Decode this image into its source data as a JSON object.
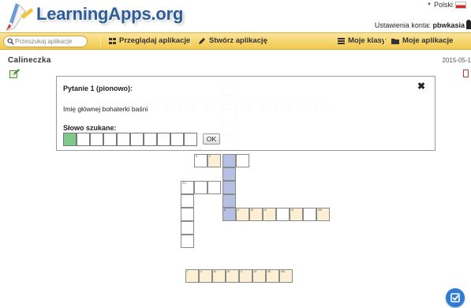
{
  "header": {
    "logo_text": "LearningApps.org",
    "language": "Polski",
    "account_prefix": "Ustawienia konta:",
    "account_user": "pbwkasia"
  },
  "nav": {
    "search_placeholder": "Przeszukaj aplikacje",
    "browse": "Przeglądaj aplikacje",
    "create": "Stwórz aplikację",
    "classes": "Moje klasy",
    "my_apps": "Moje aplikacje"
  },
  "page": {
    "title": "Calineczka",
    "date": "2015-05-1"
  },
  "dialog": {
    "title": "Pytanie 1 (pionowo):",
    "clue": "Imię głównej bohaterki baśni",
    "word_label": "Słowo szukane:",
    "ok_label": "OK",
    "close_glyph": "✖"
  },
  "crossword": {
    "label_5": "5",
    "label_32": "3,2",
    "label_6": "6",
    "roman": [
      "I",
      "II",
      "III",
      "IV",
      "V",
      "VI",
      "VII",
      "VIII"
    ]
  },
  "colors": {
    "accent_blue": "#2e5b9a",
    "nav_gold": "#f2c94e",
    "cell_gold": "#fcefd4",
    "cell_blue": "#b6c0e3",
    "active_green": "#7dc98a"
  }
}
